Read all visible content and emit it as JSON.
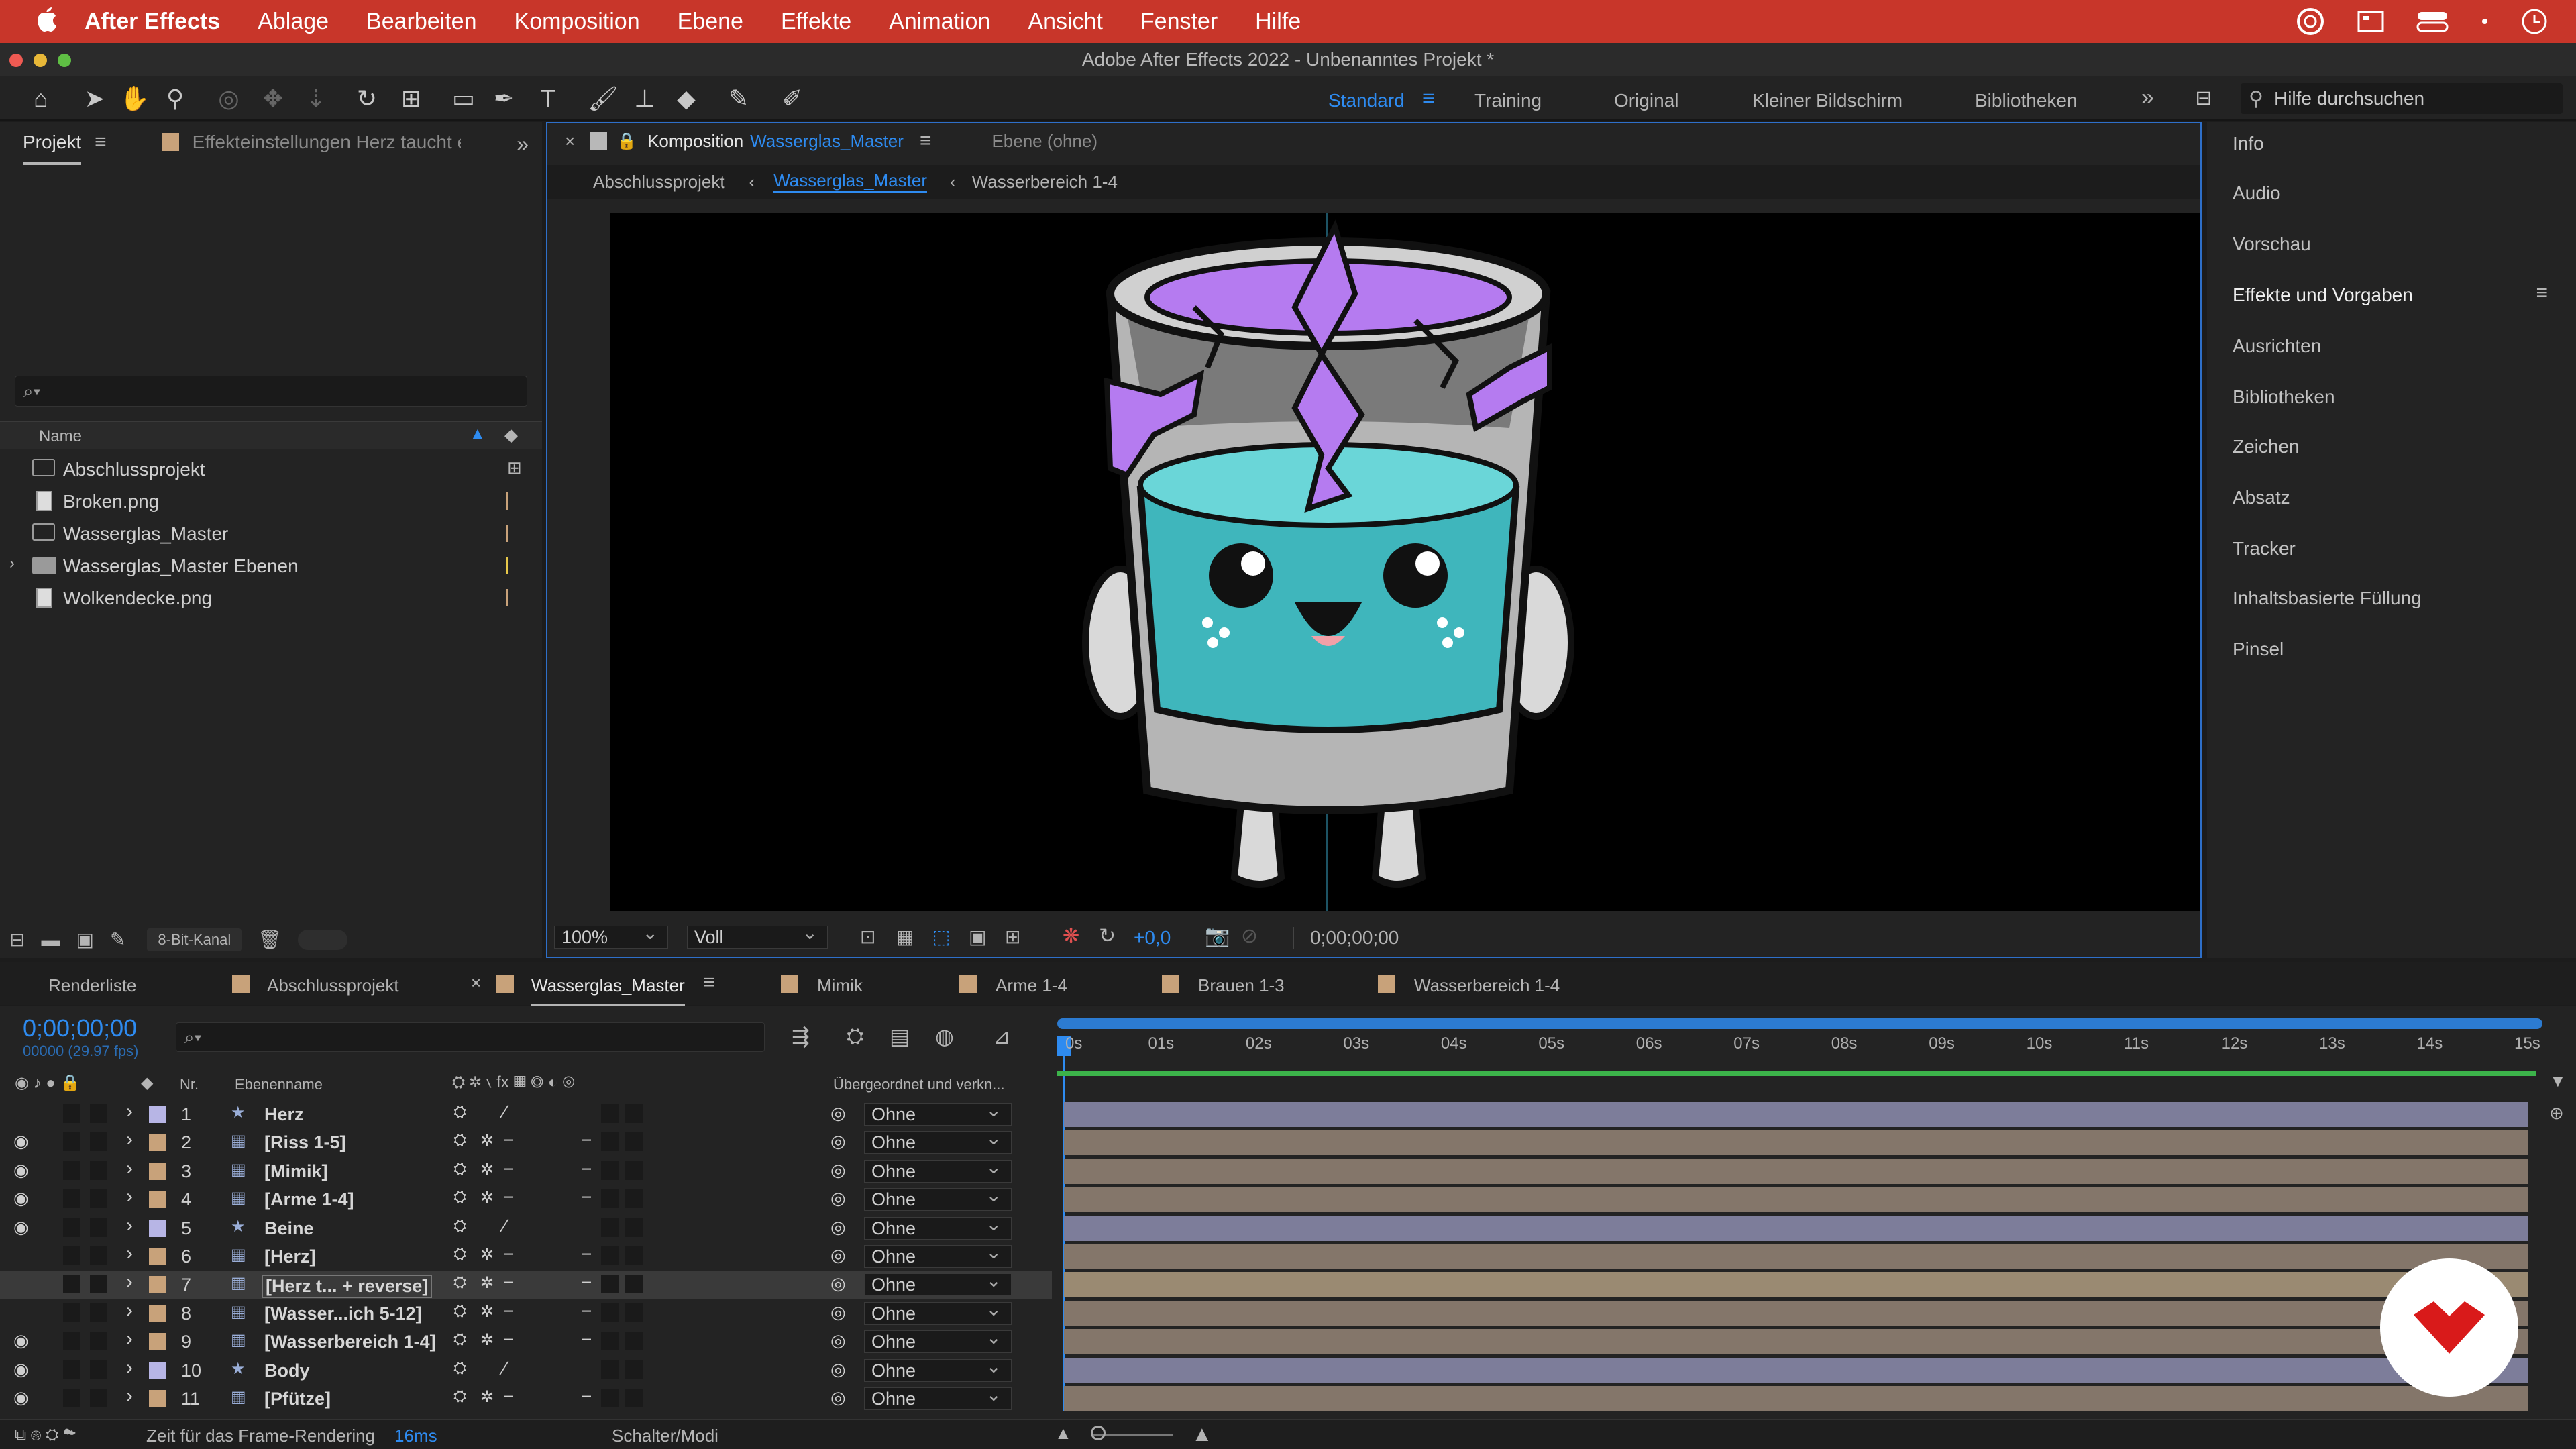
{
  "menubar": {
    "apple": "",
    "app_name": "After Effects",
    "items": [
      "Ablage",
      "Bearbeiten",
      "Komposition",
      "Ebene",
      "Effekte",
      "Animation",
      "Ansicht",
      "Fenster",
      "Hilfe"
    ]
  },
  "window": {
    "title": "Adobe After Effects 2022 - Unbenanntes Projekt *"
  },
  "workspaces": {
    "active": "Standard",
    "items": [
      "Training",
      "Original",
      "Kleiner Bildschirm",
      "Bibliotheken"
    ],
    "more": "»"
  },
  "search_help": {
    "placeholder": "Hilfe durchsuchen"
  },
  "project_panel": {
    "tab_label": "Projekt",
    "effect_settings_tab": "Effekteinstellungen Herz taucht e",
    "search_prefix": "⌕▾",
    "col_name": "Name",
    "items": [
      {
        "name": "Abschlussprojekt",
        "type": "comp"
      },
      {
        "name": "Broken.png",
        "type": "file"
      },
      {
        "name": "Wasserglas_Master",
        "type": "comp"
      },
      {
        "name": "Wasserglas_Master Ebenen",
        "type": "folder"
      },
      {
        "name": "Wolkendecke.png",
        "type": "file"
      }
    ],
    "bit_depth": "8-Bit-Kanal"
  },
  "comp_viewer": {
    "tab_prefix": "Komposition",
    "comp_name": "Wasserglas_Master",
    "layer_tab": "Ebene (ohne)",
    "breadcrumbs": [
      "Abschlussprojekt",
      "Wasserglas_Master",
      "Wasserbereich 1-4"
    ],
    "zoom": "100%",
    "resolution": "Voll",
    "exposure": "+0,0",
    "timecode": "0;00;00;00"
  },
  "right_panel": {
    "items": [
      "Info",
      "Audio",
      "Vorschau",
      "Effekte und Vorgaben",
      "Ausrichten",
      "Bibliotheken",
      "Zeichen",
      "Absatz",
      "Tracker",
      "Inhaltsbasierte Füllung",
      "Pinsel"
    ],
    "highlighted": "Effekte und Vorgaben"
  },
  "timeline_tabs": [
    "Renderliste",
    "Abschlussprojekt",
    "Wasserglas_Master",
    "Mimik",
    "Arme 1-4",
    "Brauen 1-3",
    "Wasserbereich 1-4"
  ],
  "timeline": {
    "timecode": "0;00;00;00",
    "frame_info": "00000 (29.97 fps)",
    "search_prefix": "⌕▾",
    "col_nr": "Nr.",
    "col_name": "Ebenenname",
    "col_parent": "Übergeordnet und verkn...",
    "ruler": [
      "0s",
      "01s",
      "02s",
      "03s",
      "04s",
      "05s",
      "06s",
      "07s",
      "08s",
      "09s",
      "10s",
      "11s",
      "12s",
      "13s",
      "14s",
      "15s"
    ],
    "layers": [
      {
        "nr": "1",
        "name": "Herz",
        "color": "#b7b5e5",
        "kind": "shape",
        "parent": "Ohne",
        "visible": false
      },
      {
        "nr": "2",
        "name": "[Riss 1-5]",
        "color": "#c8a27a",
        "kind": "comp",
        "parent": "Ohne",
        "visible": true
      },
      {
        "nr": "3",
        "name": "[Mimik]",
        "color": "#c8a27a",
        "kind": "comp",
        "parent": "Ohne",
        "visible": true
      },
      {
        "nr": "4",
        "name": "[Arme 1-4]",
        "color": "#c8a27a",
        "kind": "comp",
        "parent": "Ohne",
        "visible": true
      },
      {
        "nr": "5",
        "name": "Beine",
        "color": "#b7b5e5",
        "kind": "shape",
        "parent": "Ohne",
        "visible": true
      },
      {
        "nr": "6",
        "name": "[Herz]",
        "color": "#c8a27a",
        "kind": "comp",
        "parent": "Ohne",
        "visible": false
      },
      {
        "nr": "7",
        "name": "[Herz t... + reverse]",
        "color": "#c8a27a",
        "kind": "comp",
        "parent": "Ohne",
        "visible": false
      },
      {
        "nr": "8",
        "name": "[Wasser...ich 5-12]",
        "color": "#c8a27a",
        "kind": "comp",
        "parent": "Ohne",
        "visible": false
      },
      {
        "nr": "9",
        "name": "[Wasserbereich 1-4]",
        "color": "#c8a27a",
        "kind": "comp",
        "parent": "Ohne",
        "visible": true
      },
      {
        "nr": "10",
        "name": "Body",
        "color": "#b7b5e5",
        "kind": "shape",
        "parent": "Ohne",
        "visible": true
      },
      {
        "nr": "11",
        "name": "[Pfütze]",
        "color": "#c8a27a",
        "kind": "comp",
        "parent": "Ohne",
        "visible": true
      }
    ],
    "selected_layer": "7"
  },
  "statusbar": {
    "render_label": "Zeit für das Frame-Rendering",
    "render_time": "16ms",
    "modes": "Schalter/Modi"
  },
  "colors": {
    "menubar": "#c8362a",
    "accent_blue": "#2e8bf0",
    "layer_purple": "#b7b5e5",
    "layer_tan": "#c8a27a",
    "bar_shape": "#7d7d9a",
    "bar_comp": "#84766a"
  }
}
